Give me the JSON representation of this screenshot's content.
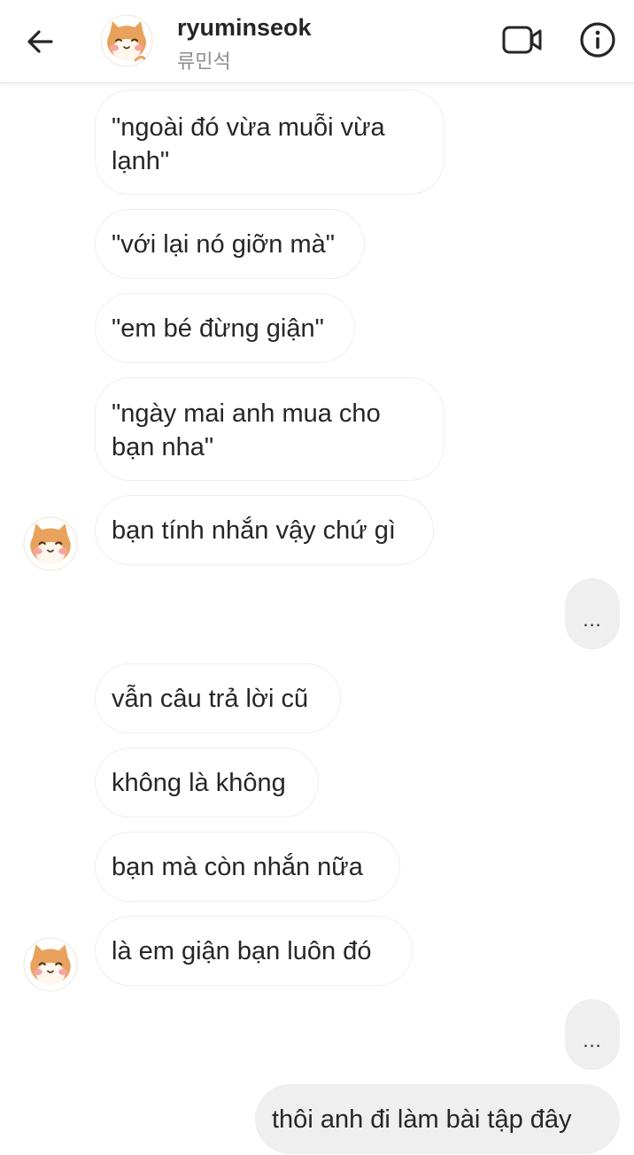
{
  "header": {
    "username": "ryuminseok",
    "subtitle": "류민석",
    "icons": [
      "back-arrow-icon",
      "avatar-shiba",
      "video-call-icon",
      "info-icon"
    ]
  },
  "messages": [
    {
      "from": "them",
      "text": "\"ngoài đó vừa muỗi vừa lạnh\""
    },
    {
      "from": "them",
      "text": "\"với lại nó giỡn mà\""
    },
    {
      "from": "them",
      "text": "\"em bé đừng giận\""
    },
    {
      "from": "them",
      "text": "\"ngày mai anh mua cho bạn nha\""
    },
    {
      "from": "them",
      "text": "bạn tính nhắn vậy chứ gì"
    },
    {
      "from": "me",
      "text": "..."
    },
    {
      "from": "them",
      "text": "vẫn câu trả lời cũ"
    },
    {
      "from": "them",
      "text": "không là không"
    },
    {
      "from": "them",
      "text": "bạn mà còn nhắn nữa"
    },
    {
      "from": "them",
      "text": "là em giận bạn luôn đó"
    },
    {
      "from": "me",
      "text": "..."
    },
    {
      "from": "me",
      "text": "thôi anh đi làm bài tập đây"
    }
  ],
  "colors": {
    "incoming_bubble": "#ffffff",
    "incoming_border": "#efefef",
    "outgoing_bubble": "#efefef",
    "text": "#262626",
    "muted": "#8e8e8e"
  }
}
